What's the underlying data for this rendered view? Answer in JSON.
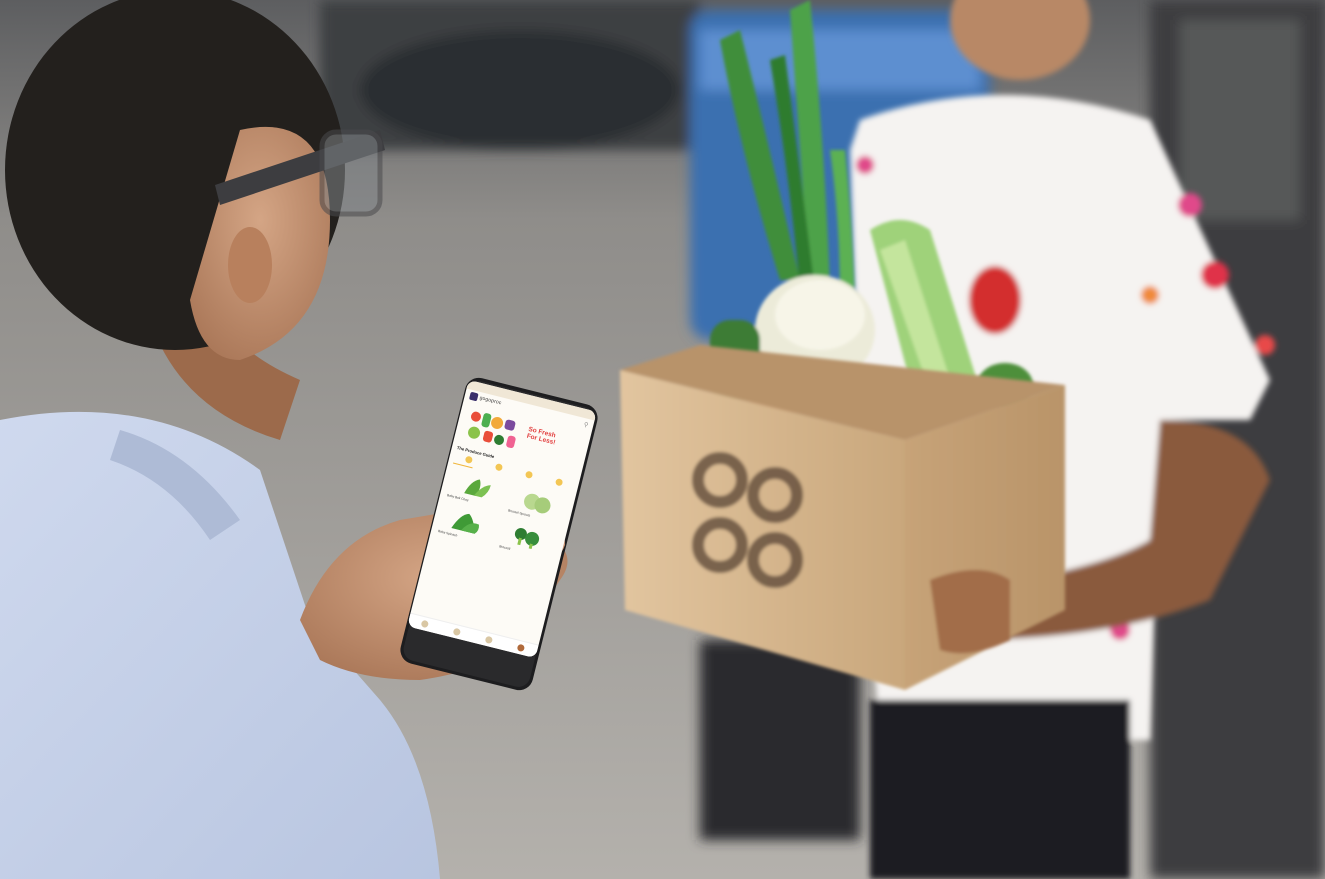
{
  "scene": {
    "colors": {
      "background_street": "#a9a6a1",
      "shirt_left": "#c3cfe8",
      "box_cardboard": "#d8b88e",
      "shirt_right": "#f5f3f1",
      "accent_red": "#d32f2f",
      "phone_body": "#1d1d1f"
    }
  },
  "phone_app": {
    "brand": "gogoproc",
    "tagline_line1": "So Fresh",
    "tagline_line2": "For Less!",
    "section_title": "The Produce Guide",
    "categories": [
      {
        "label": ""
      },
      {
        "label": ""
      },
      {
        "label": ""
      },
      {
        "label": ""
      }
    ],
    "products": [
      {
        "name": "Baby Bok Choy",
        "icon": "leafy-greens-icon"
      },
      {
        "name": "Brussel Sprouts",
        "icon": "cabbage-icon"
      },
      {
        "name": "Baby Spinach",
        "icon": "spinach-icon"
      },
      {
        "name": "Broccoli",
        "icon": "broccoli-icon"
      }
    ],
    "nav_icons": [
      "home-icon",
      "basket-icon",
      "offers-icon",
      "profile-avatar-icon"
    ]
  }
}
